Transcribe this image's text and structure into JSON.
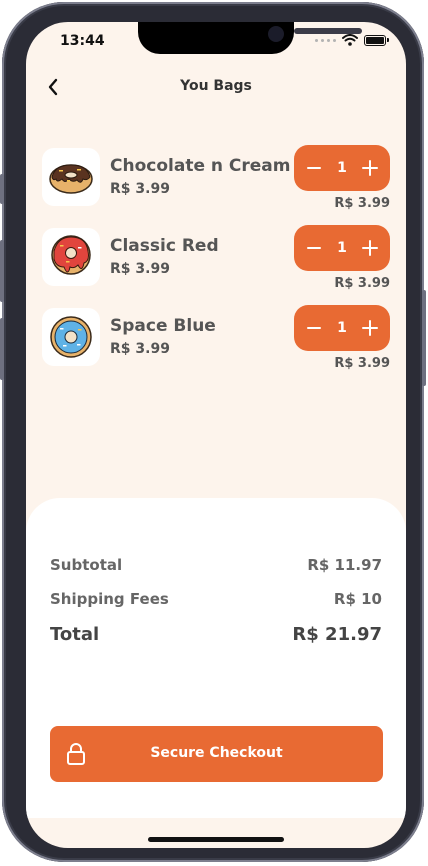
{
  "status_bar": {
    "time": "13:44"
  },
  "header": {
    "title": "You Bags"
  },
  "cart": {
    "items": [
      {
        "name": "Chocolate n Cream",
        "price": "R$ 3.99",
        "qty": "1",
        "line_total": "R$ 3.99",
        "icon": "chocolate-donut-icon"
      },
      {
        "name": "Classic Red",
        "price": "R$ 3.99",
        "qty": "1",
        "line_total": "R$ 3.99",
        "icon": "red-donut-icon"
      },
      {
        "name": "Space Blue",
        "price": "R$ 3.99",
        "qty": "1",
        "line_total": "R$ 3.99",
        "icon": "blue-donut-icon"
      }
    ]
  },
  "summary": {
    "subtotal_label": "Subtotal",
    "subtotal_value": "R$ 11.97",
    "shipping_label": "Shipping Fees",
    "shipping_value": "R$ 10",
    "total_label": "Total",
    "total_value": "R$ 21.97"
  },
  "checkout": {
    "label": "Secure Checkout"
  },
  "colors": {
    "accent": "#e86a33",
    "background": "#fdf4ec",
    "text": "#555555"
  }
}
